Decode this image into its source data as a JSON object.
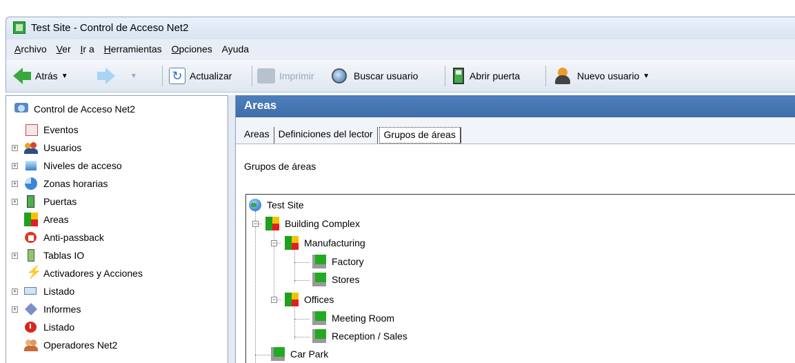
{
  "window": {
    "title": "Test Site - Control de Acceso Net2"
  },
  "menu": [
    {
      "underline": "A",
      "rest": "rchivo"
    },
    {
      "underline": "V",
      "rest": "er"
    },
    {
      "underline": "I",
      "rest": "r a"
    },
    {
      "underline": "H",
      "rest": "erramientas"
    },
    {
      "underline": "O",
      "rest": "pciones"
    },
    {
      "underline": "",
      "rest": "Ayuda"
    }
  ],
  "toolbar": {
    "back_label": "Atrás",
    "refresh_label": "Actualizar",
    "print_label": "Imprimir",
    "search_user_label": "Buscar usuario",
    "open_door_label": "Abrir puerta",
    "new_user_label": "Nuevo usuario"
  },
  "nav": {
    "root": "Control de Acceso Net2",
    "items": [
      {
        "label": "Eventos",
        "icon": "calendar-icon",
        "expandable": false
      },
      {
        "label": "Usuarios",
        "icon": "users-icon",
        "expandable": true
      },
      {
        "label": "Niveles de acceso",
        "icon": "access-levels-icon",
        "expandable": true
      },
      {
        "label": "Zonas horarias",
        "icon": "clock-icon",
        "expandable": true
      },
      {
        "label": "Puertas",
        "icon": "door-icon",
        "expandable": true
      },
      {
        "label": "Areas",
        "icon": "area-icon",
        "expandable": false,
        "selected": true
      },
      {
        "label": "Anti-passback",
        "icon": "anti-passback-icon",
        "expandable": false
      },
      {
        "label": "Tablas IO",
        "icon": "io-table-icon",
        "expandable": true
      },
      {
        "label": "Activadores y  Acciones",
        "icon": "lightning-icon",
        "expandable": false
      },
      {
        "label": "Listado",
        "icon": "roll-call-icon",
        "expandable": true
      },
      {
        "label": "Informes",
        "icon": "reports-icon",
        "expandable": true
      },
      {
        "label": "Listado",
        "icon": "alarm-icon",
        "expandable": false
      },
      {
        "label": "Operadores Net2",
        "icon": "operators-icon",
        "expandable": false
      }
    ]
  },
  "content": {
    "header": "Areas",
    "tabs": [
      "Areas",
      "Definiciones del lector",
      "Grupos de áreas"
    ],
    "active_tab": 2,
    "group_label": "Grupos de áreas",
    "tree": {
      "root": "Test Site",
      "nodes": [
        {
          "label": "Building Complex",
          "level": 1,
          "type": "group"
        },
        {
          "label": "Manufacturing",
          "level": 2,
          "type": "group"
        },
        {
          "label": "Factory",
          "level": 3,
          "type": "area"
        },
        {
          "label": "Stores",
          "level": 3,
          "type": "area"
        },
        {
          "label": "Offices",
          "level": 2,
          "type": "group"
        },
        {
          "label": "Meeting Room",
          "level": 3,
          "type": "area"
        },
        {
          "label": "Reception / Sales",
          "level": 3,
          "type": "area"
        },
        {
          "label": "Car Park",
          "level": 1,
          "type": "area"
        }
      ]
    }
  }
}
